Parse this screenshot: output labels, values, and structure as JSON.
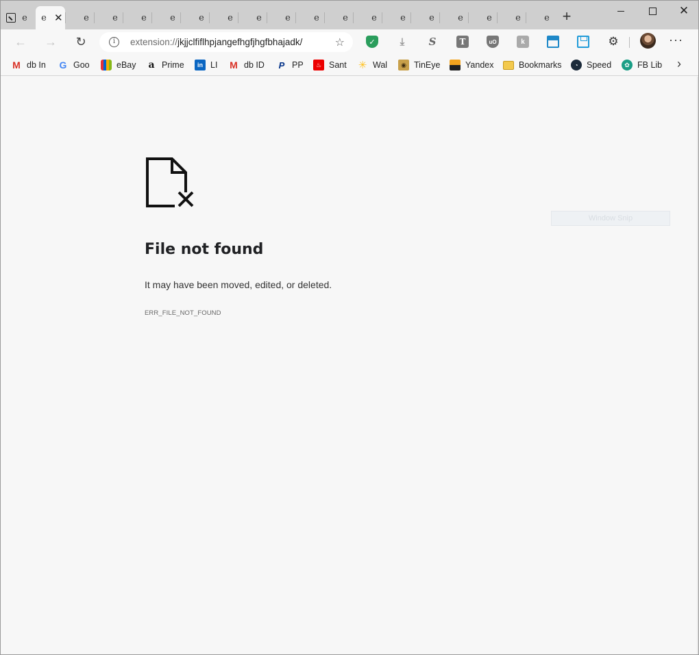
{
  "tabs": {
    "first_label": "e",
    "active_label": "e",
    "background_labels": [
      "e",
      "e",
      "e",
      "e",
      "e",
      "e",
      "e",
      "e",
      "e",
      "e",
      "e",
      "e",
      "e",
      "e",
      "e",
      "e",
      "e"
    ]
  },
  "toolbar": {
    "url_scheme": "extension://",
    "url_rest": "jkjjclfiflhpjangefhgfjhgfbhajadk/",
    "extensions": [
      "shield-icon",
      "download-icon",
      "s-icon",
      "t-icon",
      "ublock-icon",
      "k-icon",
      "window-snip-icon",
      "save-icon",
      "puzzle-icon"
    ],
    "accent_green": "#2a9d5c",
    "accent_blue": "#1e88c8"
  },
  "bookmarks": [
    {
      "label": "db In",
      "icon": "gmail-icon"
    },
    {
      "label": "Goo",
      "icon": "google-icon"
    },
    {
      "label": "eBay",
      "icon": "ebay-icon"
    },
    {
      "label": "Prime",
      "icon": "amazon-icon"
    },
    {
      "label": "LI",
      "icon": "linkedin-icon"
    },
    {
      "label": "db ID",
      "icon": "gmail-icon"
    },
    {
      "label": "PP",
      "icon": "paypal-icon"
    },
    {
      "label": "Sant",
      "icon": "santander-icon"
    },
    {
      "label": "Wal",
      "icon": "walmart-icon"
    },
    {
      "label": "TinEye",
      "icon": "tineye-icon"
    },
    {
      "label": "Yandex",
      "icon": "yandex-icon"
    },
    {
      "label": "Bookmarks",
      "icon": "folder-icon"
    },
    {
      "label": "Speed",
      "icon": "speed-icon"
    },
    {
      "label": "FB Lib",
      "icon": "fb-library-icon"
    }
  ],
  "error": {
    "title": "File not found",
    "description": "It may have been moved, edited, or deleted.",
    "code": "ERR_FILE_NOT_FOUND"
  },
  "overlay": {
    "window_snip": "Window Snip"
  }
}
